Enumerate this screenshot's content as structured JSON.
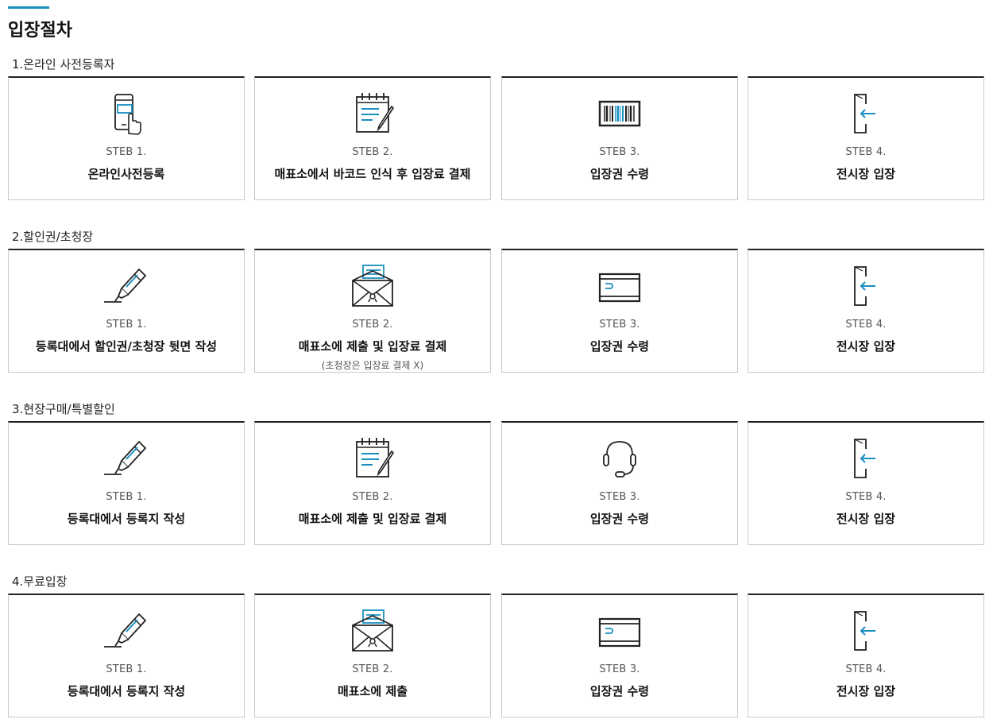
{
  "page": {
    "title": "입장절차"
  },
  "colors": {
    "accent": "#1a8fc0",
    "border": "#c9c9c9",
    "top_border": "#222222"
  },
  "sections": [
    {
      "title": "1.온라인 사전등록자",
      "steps": [
        {
          "icon": "phone-touch-icon",
          "step": "STEB 1.",
          "label": "온라인사전등록"
        },
        {
          "icon": "notepad-pen-icon",
          "step": "STEB 2.",
          "label": "매표소에서 바코드 인식 후 입장료 결제"
        },
        {
          "icon": "barcode-icon",
          "step": "STEB 3.",
          "label": "입장권 수령"
        },
        {
          "icon": "door-enter-icon",
          "step": "STEB 4.",
          "label": "전시장 입장"
        }
      ]
    },
    {
      "title": "2.할인권/초청장",
      "steps": [
        {
          "icon": "highlighter-icon",
          "step": "STEB 1.",
          "label": "등록대에서 할인권/초청장 뒷면 작성"
        },
        {
          "icon": "envelope-icon",
          "step": "STEB 2.",
          "label": "매표소에 제출 및 입장료 결제",
          "sub": "(초청장은 입장료 결제 X)"
        },
        {
          "icon": "wallet-icon",
          "step": "STEB 3.",
          "label": "입장권 수령"
        },
        {
          "icon": "door-enter-icon",
          "step": "STEB 4.",
          "label": "전시장 입장"
        }
      ]
    },
    {
      "title": "3.현장구매/특별할인",
      "steps": [
        {
          "icon": "highlighter-icon",
          "step": "STEB 1.",
          "label": "등록대에서 등록지 작성"
        },
        {
          "icon": "notepad-pen-icon",
          "step": "STEB 2.",
          "label": "매표소에 제출 및 입장료 결제"
        },
        {
          "icon": "headset-icon",
          "step": "STEB 3.",
          "label": "입장권 수령"
        },
        {
          "icon": "door-enter-icon",
          "step": "STEB 4.",
          "label": "전시장 입장"
        }
      ]
    },
    {
      "title": "4.무료입장",
      "steps": [
        {
          "icon": "highlighter-icon",
          "step": "STEB 1.",
          "label": "등록대에서 등록지 작성"
        },
        {
          "icon": "envelope-icon",
          "step": "STEB 2.",
          "label": "매표소에 제출"
        },
        {
          "icon": "wallet-icon",
          "step": "STEB 3.",
          "label": "입장권 수령"
        },
        {
          "icon": "door-enter-icon",
          "step": "STEB 4.",
          "label": "전시장 입장"
        }
      ]
    }
  ]
}
